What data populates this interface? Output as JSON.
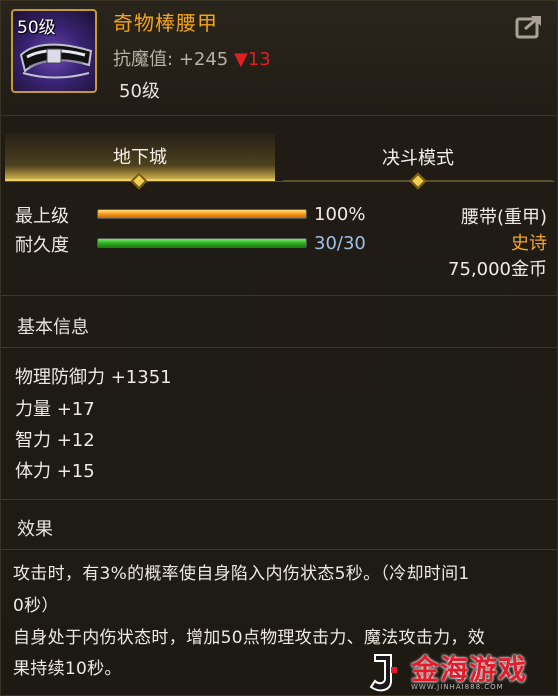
{
  "item": {
    "icon_level": "50级",
    "name": "奇物棒腰甲",
    "stat_label": "抗魔值:",
    "stat_value": "+245",
    "stat_change_arrow": "▼",
    "stat_change": "13",
    "required_level": "50级",
    "icon_name": "belt-icon"
  },
  "tabs": [
    {
      "label": "地下城",
      "active": true
    },
    {
      "label": "决斗模式",
      "active": false
    }
  ],
  "status": {
    "grade_label": "最上级",
    "grade_percent": 1.0,
    "grade_value": "100%",
    "durability_label": "耐久度",
    "durability_fraction": 1.0,
    "durability_value": "30/30"
  },
  "info": {
    "type": "腰带(重甲)",
    "rarity": "史诗",
    "price": "75,000金币"
  },
  "basic": {
    "title": "基本信息",
    "attributes": [
      "物理防御力 +1351",
      "力量 +17",
      "智力 +12",
      "体力 +15"
    ]
  },
  "effect": {
    "title": "效果",
    "line1": "攻击时，有3%的概率使自身陷入内伤状态5秒。（冷却时间1",
    "line2": "0秒）",
    "line3": "自身处于内伤状态时，增加50点物理攻击力、魔法攻击力，效",
    "line4": "果持续10秒。"
  },
  "watermark": {
    "text": "金海游戏",
    "sub": "WWW.JINHAI888.COM"
  },
  "colors": {
    "item_name": "#f3a21b",
    "rarity": "#f5a623",
    "stat_down": "#e02020",
    "durability_text": "#9fc0e4"
  }
}
